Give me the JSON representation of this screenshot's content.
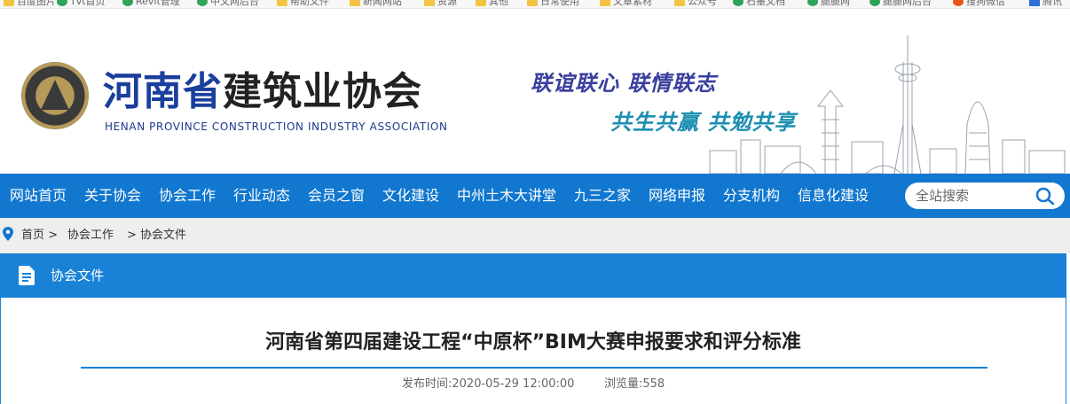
{
  "bookmarks": [
    {
      "label": "百度图片",
      "icon": "folder-icon"
    },
    {
      "label": "Tvt首页",
      "icon": "green-dot-icon"
    },
    {
      "label": "Revit管理",
      "icon": "green-dot-icon"
    },
    {
      "label": "中文网后台",
      "icon": "green-dot-icon"
    },
    {
      "label": "帮助文件",
      "icon": "folder-icon"
    },
    {
      "label": "新闻网站",
      "icon": "folder-icon"
    },
    {
      "label": "资源",
      "icon": "folder-icon"
    },
    {
      "label": "其他",
      "icon": "folder-icon"
    },
    {
      "label": "日常使用",
      "icon": "folder-icon"
    },
    {
      "label": "文章素材",
      "icon": "folder-icon"
    },
    {
      "label": "公众号",
      "icon": "folder-icon"
    },
    {
      "label": "石墨文档",
      "icon": "green-dot-icon"
    },
    {
      "label": "腿腿网",
      "icon": "green-dot-icon"
    },
    {
      "label": "腿腿网后台",
      "icon": "green-dot-icon"
    },
    {
      "label": "搜狗微信",
      "icon": "red-dot-icon"
    },
    {
      "label": "腾讯",
      "icon": "blue-icon"
    }
  ],
  "header": {
    "title_part1": "河南省",
    "title_part2": "建筑业协会",
    "subtitle": "HENAN PROVINCE CONSTRUCTION INDUSTRY ASSOCIATION",
    "slogan_line1": "联谊联心  联情联志",
    "slogan_line2": "共生共赢 共勉共享"
  },
  "nav": {
    "items": [
      "网站首页",
      "关于协会",
      "协会工作",
      "行业动态",
      "会员之窗",
      "文化建设",
      "中州土木大讲堂",
      "九三之家",
      "网络申报",
      "分支机构",
      "信息化建设"
    ],
    "search_placeholder": "全站搜索"
  },
  "breadcrumb": {
    "items": [
      "首页 >",
      "协会工作",
      "> 协会文件"
    ]
  },
  "panel": {
    "title": "协会文件"
  },
  "article": {
    "title": "河南省第四届建设工程“中原杯”BIM大赛申报要求和评分标准",
    "publish_time": "发布时间:2020-05-29 12:00:00",
    "views": "浏览量:558"
  },
  "colors": {
    "nav_blue": "#1177cf",
    "panel_blue": "#1a82d6",
    "title_blue": "#1a3f9c",
    "slogan_purple": "#3a3f9e",
    "slogan_teal": "#1c8fb0"
  }
}
